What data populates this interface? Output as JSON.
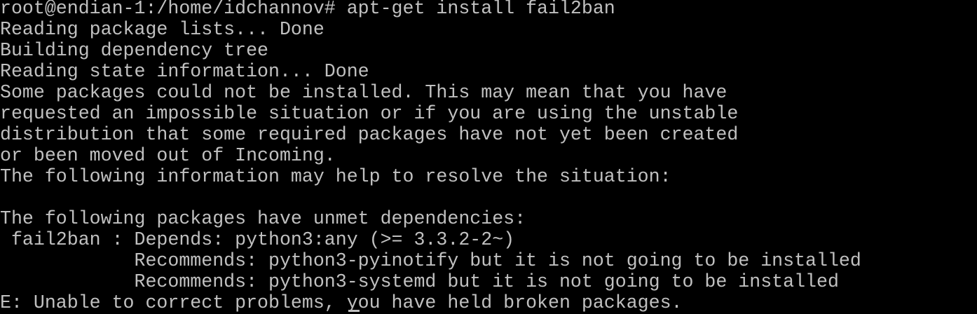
{
  "terminal": {
    "lines": [
      "root@endian-1:/home/idchannov# apt-get install fail2ban",
      "Reading package lists... Done",
      "Building dependency tree",
      "Reading state information... Done",
      "Some packages could not be installed. This may mean that you have",
      "requested an impossible situation or if you are using the unstable",
      "distribution that some required packages have not yet been created",
      "or been moved out of Incoming.",
      "The following information may help to resolve the situation:",
      "",
      "The following packages have unmet dependencies:",
      " fail2ban : Depends: python3:any (>= 3.3.2-2~)",
      "            Recommends: python3-pyinotify but it is not going to be installed",
      "            Recommends: python3-systemd but it is not going to be installed",
      "E: Unable to correct problems, you have held broken packages."
    ],
    "colors": {
      "background": "#000000",
      "foreground": "#c0c0c0"
    }
  }
}
